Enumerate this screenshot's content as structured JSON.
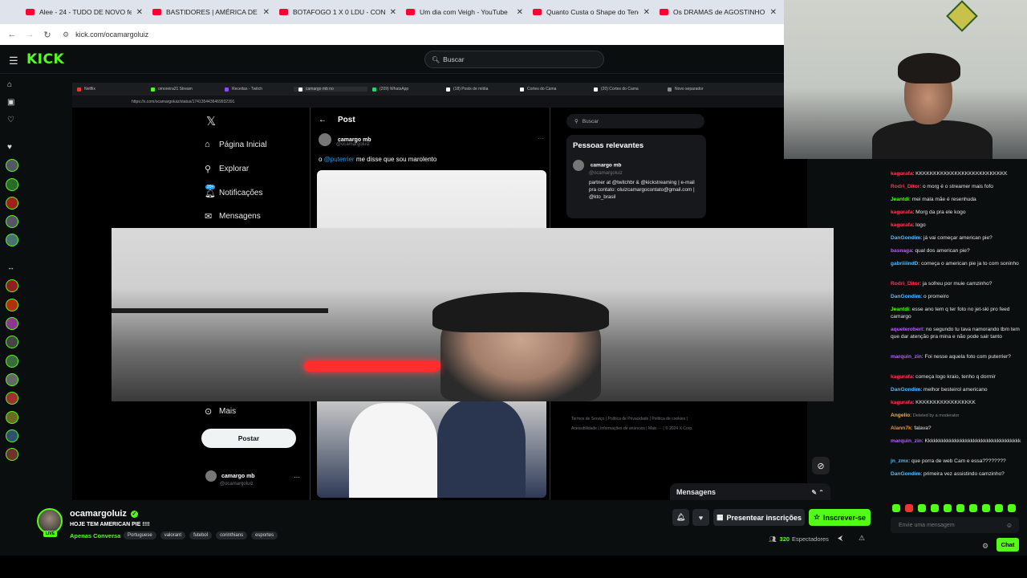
{
  "browser": {
    "tabs": [
      {
        "title": "Alee - 24 - TUDO DE NOVO fe"
      },
      {
        "title": "BASTIDORES | AMÉRICA DE CA"
      },
      {
        "title": "BOTAFOGO 1 X 0 LDU - CONM"
      },
      {
        "title": "Um dia com Veigh - YouTube"
      },
      {
        "title": "Quanto Custa o Shape do Tene"
      },
      {
        "title": "Os DRAMAS de AGOSTINHO C"
      }
    ],
    "url": "kick.com/ocamargoluiz"
  },
  "kick_header": {
    "logo": "KICK",
    "search_placeholder": "Buscar"
  },
  "stream_content": {
    "inner_tabs": [
      "Netflix",
      "omoreira21 Stream",
      "Receitas - Twitch",
      "camargo mb no",
      "(209) WhatsApp",
      "(18) Posts de mídia",
      "Cortes do Cama",
      "(20) Cortes do Cama",
      "Novo separador"
    ],
    "inner_url": "https://x.com/ocamargoluiz/status/1741354436469932391",
    "x_nav": [
      "Página Inicial",
      "Explorar",
      "Notificações",
      "Mensagens",
      "Mais"
    ],
    "notif_badge": "20+",
    "post_button": "Postar",
    "post_header": "Post",
    "author_name": "camargo mb",
    "author_handle": "@ocamargoluiz",
    "post_text_mention": "@puterrier",
    "post_text_rest": " me disse que sou marolento",
    "o_prefix": "o ",
    "x_search": "Buscar",
    "relevant_title": "Pessoas relevantes",
    "relevant_bio": "partner at @twitchbr & @kickstreaming | e-mail pra contato: oluizcamargocontato@gmail.com | @kto_brasil",
    "footer_links": "Termos de Serviço | Política de Privacidade | Política de cookies | Acessibilidade | Informações de anúncios | Mais ··· | © 2024 X Corp.",
    "messages_bar": "Mensagens"
  },
  "channel": {
    "name": "ocamargoluiz",
    "live_badge": "LIVE",
    "stream_title": "HOJE TEM AMERICAN PIE !!!!",
    "category": "Apenas Conversa",
    "tags": [
      "Portuguese",
      "valorant",
      "futebol",
      "corinthians",
      "esportes"
    ],
    "gift_subs_label": "Presentear inscrições",
    "subscribe_label": "Inscrever-se",
    "viewer_count": "320",
    "viewers_label": "Espectadores"
  },
  "chat": {
    "messages": [
      {
        "user": "kagurafa",
        "text": "KKKKKKKKKKKKKKKKKKKKKKKKKK",
        "color": "#ff3355"
      },
      {
        "user": "Rodri_Ditor",
        "text": "o morg é o streamer mais fofo",
        "color": "#ff3355"
      },
      {
        "user": "Jeantdi",
        "text": "mei mala mãe é resenhuda",
        "color": "#53fc18"
      },
      {
        "user": "kagurafa",
        "text": "Morg da pra ele kogo",
        "color": "#ff3355"
      },
      {
        "user": "kagurafa",
        "text": "logo",
        "color": "#ff3355"
      },
      {
        "user": "DanGondim",
        "text": "já vai começar american pie?",
        "color": "#53b8fc"
      },
      {
        "user": "basnaga",
        "text": "qual dos american pie?",
        "color": "#b85cff"
      },
      {
        "user": "gabriiiindD",
        "text": "começa o american pie ja to com soninho",
        "color": "#53b8fc"
      },
      {
        "user": "Rodri_Ditor",
        "text": "ja sofreu por muie camzinho?",
        "color": "#ff3355"
      },
      {
        "user": "DanGondim",
        "text": "o promeiro",
        "color": "#53b8fc"
      },
      {
        "user": "Jeantdi",
        "text": "esse ano tem q ter foto no jet-ski pro feed camargo",
        "color": "#53fc18"
      },
      {
        "user": "aqueterobert",
        "text": "no segundo tu tava namorando tbm tem que dar atenção pra mina e não pode sair tanto",
        "color": "#b85cff"
      },
      {
        "user": "marquin_zin",
        "text": "Foi nesse aquela foto com puterrier?",
        "color": "#b85cff"
      },
      {
        "user": "kagurafa",
        "text": "começa logo kraio, tenho q dormir",
        "color": "#ff3355"
      },
      {
        "user": "DanGondim",
        "text": "melhor besteirol americano",
        "color": "#53b8fc"
      },
      {
        "user": "kagurafa",
        "text": "KKKKKKKKKKKKKKKKK",
        "color": "#ff3355"
      },
      {
        "user": "Angelio",
        "text": "Deleted by a moderator",
        "color": "#ffb020"
      },
      {
        "user": "Alann7k",
        "text": "falava?",
        "color": "#ff8c1a"
      },
      {
        "user": "marquin_zin",
        "text": "Kkkkkkkkkkkkkkkkkkkkkkkkkkkkkkkkkkkk",
        "color": "#b85cff"
      },
      {
        "user": "jn_zmx",
        "text": "que porra de web Cam e essa????????",
        "color": "#53b8fc"
      },
      {
        "user": "DanGondim",
        "text": "primeira vez assistindo camzinho?",
        "color": "#53b8fc"
      }
    ],
    "input_placeholder": "Envie uma mensagem",
    "send_label": "Chat"
  },
  "colors": {
    "kick_green": "#53fc18",
    "background": "#0b0e0f"
  }
}
